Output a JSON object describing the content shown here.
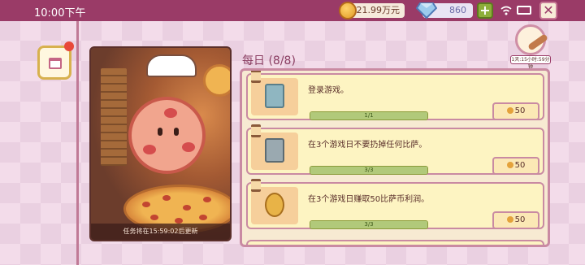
{
  "status_bar": {
    "time": "10:00下午"
  },
  "currency": {
    "coins": "21.99万元",
    "gems": "860"
  },
  "header": {
    "title": "每日 (8/8)",
    "timer_label": "1天:15小时:59分钟"
  },
  "illustration": {
    "caption": "任务将在15:59:02后更新"
  },
  "tasks": [
    {
      "description": "登录游戏。",
      "progress_text": "1/1",
      "progress": 1.0,
      "reward": "50",
      "icon": "tablet-checkmark-icon"
    },
    {
      "description": "在3个游戏日不要扔掉任何比萨。",
      "progress_text": "3/3",
      "progress": 1.0,
      "reward": "50",
      "icon": "trash-can-icon"
    },
    {
      "description": "在3个游戏日赚取50比萨币利润。",
      "progress_text": "3/3",
      "progress": 1.0,
      "reward": "50",
      "icon": "coin-stack-icon"
    }
  ],
  "colors": {
    "top_bar": "#9a3b67",
    "card_bg": "#fdf4c2",
    "progress_fill": "#b1c97a"
  }
}
